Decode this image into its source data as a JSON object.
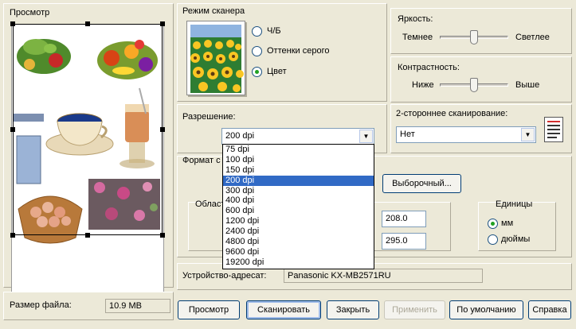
{
  "preview": {
    "title": "Просмотр"
  },
  "scan_mode": {
    "title": "Режим сканера",
    "options": [
      {
        "label": "Ч/Б",
        "selected": false
      },
      {
        "label": "Оттенки серого",
        "selected": false
      },
      {
        "label": "Цвет",
        "selected": true
      }
    ]
  },
  "brightness": {
    "title": "Яркость:",
    "min_label": "Темнее",
    "max_label": "Светлее",
    "level_fraction": 0.5
  },
  "contrast": {
    "title": "Контрастность:",
    "min_label": "Ниже",
    "max_label": "Выше",
    "level_fraction": 0.5
  },
  "resolution": {
    "title": "Разрешение:",
    "selected": "200 dpi",
    "options": [
      "75 dpi",
      "100 dpi",
      "150 dpi",
      "200 dpi",
      "300 dpi",
      "400 dpi",
      "600 dpi",
      "1200 dpi",
      "2400 dpi",
      "4800 dpi",
      "9600 dpi",
      "19200 dpi"
    ]
  },
  "duplex": {
    "title": "2-стороннее сканирование:",
    "selected": "Нет"
  },
  "format": {
    "title_partial": "Формат с",
    "custom_button": "Выборочный..."
  },
  "area": {
    "title_partial": "Област",
    "width_value": "208.0",
    "height_value": "295.0"
  },
  "units": {
    "title": "Единицы",
    "options": [
      {
        "label": "мм",
        "selected": true
      },
      {
        "label": "дюймы",
        "selected": false
      }
    ]
  },
  "destination": {
    "label": "Устройство-адресат:",
    "value": "Panasonic KX-MB2571RU"
  },
  "file_size": {
    "label": "Размер файла:",
    "value": "10.9 MB"
  },
  "buttons": {
    "preview": "Просмотр",
    "scan": "Сканировать",
    "close": "Закрыть",
    "apply": "Применить",
    "defaults": "По умолчанию",
    "help": "Справка"
  },
  "colors": {
    "selection": "#316ac5",
    "window": "#ece9d8",
    "border_dark": "#003c74"
  }
}
